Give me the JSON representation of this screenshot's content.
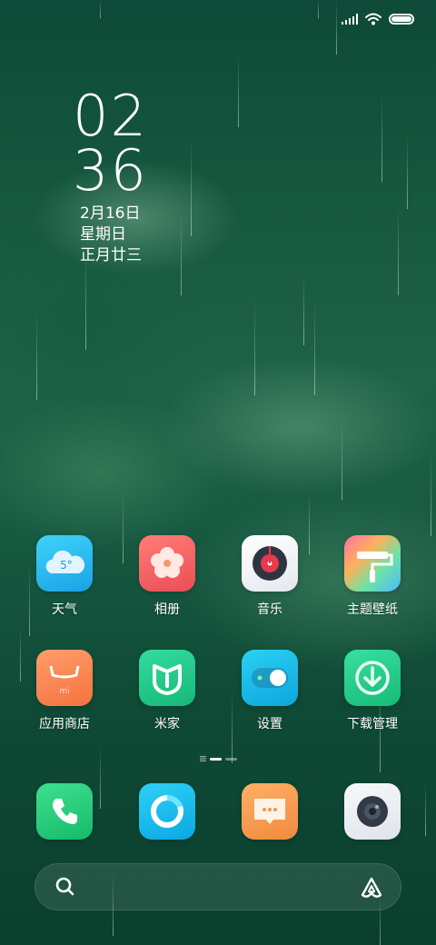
{
  "status_bar": {
    "signal": "signal-icon",
    "wifi": "wifi-icon",
    "battery": "battery-icon"
  },
  "clock": {
    "hour": "02",
    "minute": "36",
    "date": "2月16日",
    "weekday": "星期日",
    "lunar": "正月廿三"
  },
  "apps": [
    {
      "label": "天气",
      "icon": "weather-icon",
      "temp": "5°"
    },
    {
      "label": "相册",
      "icon": "gallery-icon"
    },
    {
      "label": "音乐",
      "icon": "music-icon"
    },
    {
      "label": "主题壁纸",
      "icon": "themes-icon"
    },
    {
      "label": "应用商店",
      "icon": "app-store-icon",
      "brand": "mi"
    },
    {
      "label": "米家",
      "icon": "mi-home-icon"
    },
    {
      "label": "设置",
      "icon": "settings-toggle-icon"
    },
    {
      "label": "下载管理",
      "icon": "download-icon"
    }
  ],
  "dock": [
    {
      "icon": "phone-icon"
    },
    {
      "icon": "browser-icon"
    },
    {
      "icon": "messages-icon"
    },
    {
      "icon": "camera-icon"
    }
  ],
  "search": {
    "placeholder": "",
    "icon": "search-icon",
    "assistant_icon": "assistant-icon"
  },
  "colors": {
    "weather": "#1fb6ea",
    "gallery": "#f25a5a",
    "settings": "#16b6e6",
    "download": "#21c47e",
    "phone": "#22c878",
    "browser": "#12b6e8",
    "messages": "#f5a050"
  }
}
